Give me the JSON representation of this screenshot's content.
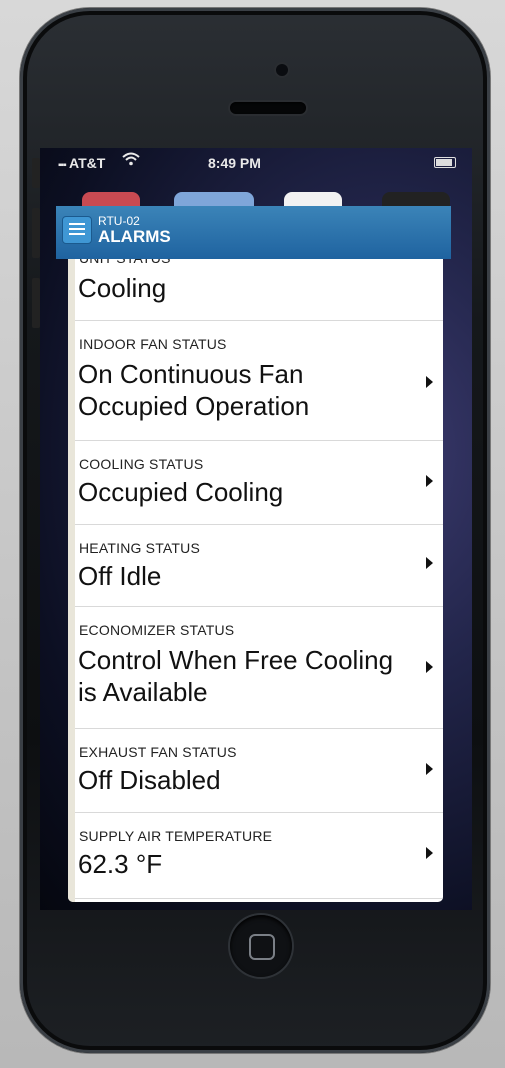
{
  "status_bar": {
    "carrier": "AT&T",
    "time": "8:49 PM"
  },
  "header": {
    "unit_name": "RTU-02",
    "title": "ALARMS"
  },
  "rows": [
    {
      "label": "UNIT STATUS",
      "value": "Cooling",
      "has_arrow": false
    },
    {
      "label": "INDOOR FAN STATUS",
      "value": "On Continuous Fan Occupied Operation",
      "has_arrow": true
    },
    {
      "label": "COOLING STATUS",
      "value": "Occupied Cooling",
      "has_arrow": true
    },
    {
      "label": "HEATING STATUS",
      "value": "Off Idle",
      "has_arrow": true
    },
    {
      "label": "ECONOMIZER STATUS",
      "value": "Control When Free Cooling is Available",
      "has_arrow": true
    },
    {
      "label": "EXHAUST FAN STATUS",
      "value": "Off Disabled",
      "has_arrow": true
    },
    {
      "label": "SUPPLY AIR TEMPERATURE",
      "value": "62.3 °F",
      "has_arrow": true
    }
  ],
  "icons": {
    "menu": "hamburger-menu-icon",
    "row_chevron": "chevron-right-icon",
    "wifi": "wifi-icon",
    "battery": "battery-icon",
    "signal": "cellular-signal-icon"
  },
  "colors": {
    "header_bg": "#2a70ad",
    "menu_button": "#3f97d4",
    "sidebar_strip": "#e9e6da"
  }
}
